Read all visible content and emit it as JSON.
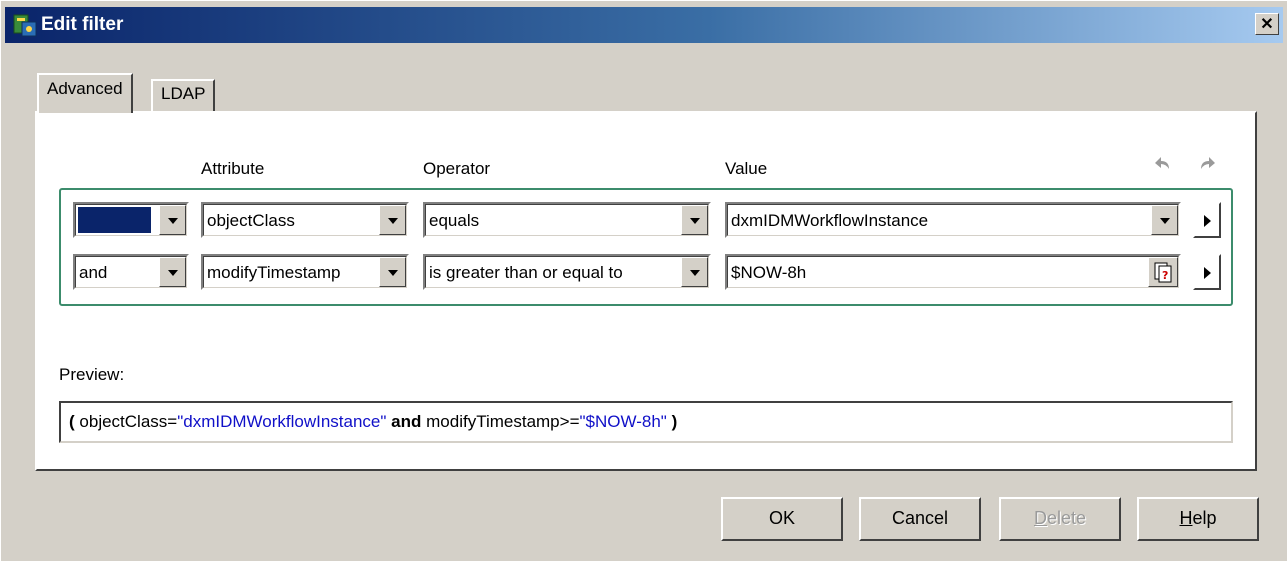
{
  "window": {
    "title": "Edit filter",
    "close_label": "✕"
  },
  "tabs": [
    {
      "label": "Advanced",
      "active": true
    },
    {
      "label": "LDAP",
      "active": false
    }
  ],
  "columns": {
    "attribute": "Attribute",
    "operator": "Operator",
    "value": "Value"
  },
  "icons": {
    "undo": "undo-icon",
    "redo": "redo-icon",
    "title": "filter-app-icon",
    "expression": "expression-icon"
  },
  "rows": [
    {
      "logic": "",
      "attribute": "objectClass",
      "operator": "equals",
      "value": "dxmIDMWorkflowInstance"
    },
    {
      "logic": "and",
      "attribute": "modifyTimestamp",
      "operator": "is greater than or equal to",
      "value": "$NOW-8h"
    }
  ],
  "preview": {
    "label": "Preview:",
    "open": "(",
    "attr1": "objectClass=",
    "val1": "\"dxmIDMWorkflowInstance\"",
    "op": "and",
    "attr2": "modifyTimestamp>=",
    "val2": "\"$NOW-8h\"",
    "close": ")"
  },
  "buttons": {
    "ok": "OK",
    "cancel": "Cancel",
    "delete": {
      "label": "Delete",
      "mnemonic": "D",
      "rest": "elete"
    },
    "help": {
      "label": "Help",
      "mnemonic": "H",
      "rest": "elp"
    }
  },
  "colors": {
    "title_start": "#0a246a",
    "title_end": "#a6caf0",
    "preview_value": "#1010c8",
    "rows_border": "#3c8c6c"
  }
}
